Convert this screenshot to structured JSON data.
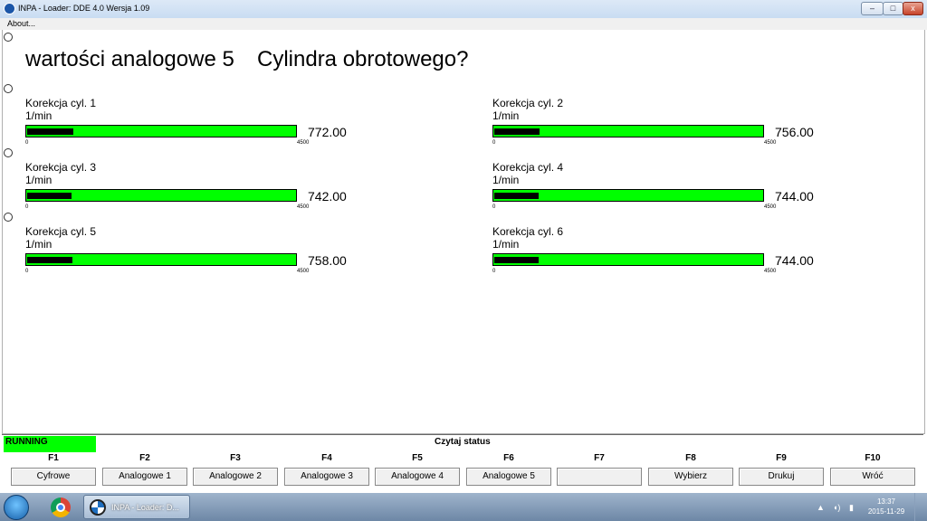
{
  "window": {
    "title": "INPA - Loader:  DDE 4.0 Wersja 1.09",
    "minimize": "–",
    "maximize": "□",
    "close": "x"
  },
  "menu": {
    "about": "About..."
  },
  "heading": {
    "left": "wartości analogowe 5",
    "right": "Cylindra obrotowego?"
  },
  "gauges": [
    {
      "label": "Korekcja cyl. 1",
      "unit": "1/min",
      "value": "772.00",
      "min": "0",
      "max": "4500",
      "fraction": 0.1716
    },
    {
      "label": "Korekcja cyl. 2",
      "unit": "1/min",
      "value": "756.00",
      "min": "0",
      "max": "4500",
      "fraction": 0.168
    },
    {
      "label": "Korekcja cyl. 3",
      "unit": "1/min",
      "value": "742.00",
      "min": "0",
      "max": "4500",
      "fraction": 0.1649
    },
    {
      "label": "Korekcja cyl. 4",
      "unit": "1/min",
      "value": "744.00",
      "min": "0",
      "max": "4500",
      "fraction": 0.1653
    },
    {
      "label": "Korekcja cyl. 5",
      "unit": "1/min",
      "value": "758.00",
      "min": "0",
      "max": "4500",
      "fraction": 0.1684
    },
    {
      "label": "Korekcja cyl. 6",
      "unit": "1/min",
      "value": "744.00",
      "min": "0",
      "max": "4500",
      "fraction": 0.1653
    }
  ],
  "status": {
    "running": "RUNNING",
    "czytaj": "Czytaj status"
  },
  "fkeys": [
    {
      "key": "F1",
      "label": "Cyfrowe"
    },
    {
      "key": "F2",
      "label": "Analogowe 1"
    },
    {
      "key": "F3",
      "label": "Analogowe 2"
    },
    {
      "key": "F4",
      "label": "Analogowe 3"
    },
    {
      "key": "F5",
      "label": "Analogowe 4"
    },
    {
      "key": "F6",
      "label": "Analogowe 5"
    },
    {
      "key": "F7",
      "label": ""
    },
    {
      "key": "F8",
      "label": "Wybierz"
    },
    {
      "key": "F9",
      "label": "Drukuj"
    },
    {
      "key": "F10",
      "label": "Wróć"
    }
  ],
  "taskbar": {
    "task_title": "INPA - Loader:  D...",
    "time": "13:37",
    "date": "2015-11-29"
  },
  "colors": {
    "bar_fill": "#00ff00",
    "running_bg": "#00ff00"
  }
}
